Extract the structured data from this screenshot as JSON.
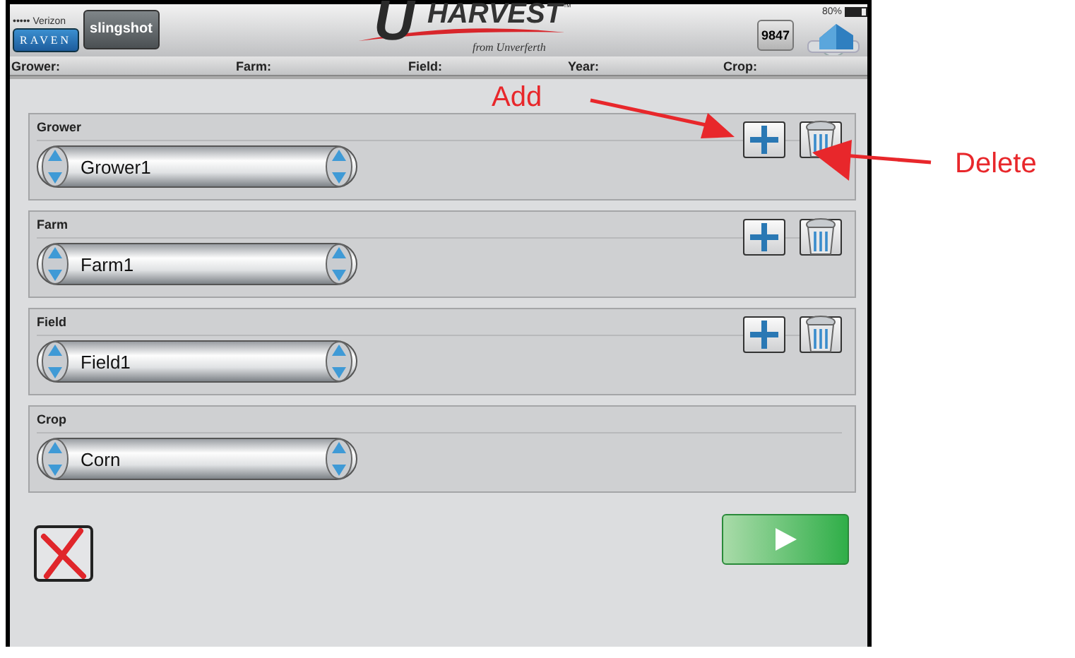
{
  "status_bar": {
    "carrier": "••••• Verizon",
    "battery": "80%"
  },
  "header": {
    "brand_button": "RAVEN",
    "app_button": "slingshot",
    "logo_initial": "U",
    "logo_name": "HARVEST",
    "logo_mark": "™",
    "logo_tagline": "from Unverferth",
    "device_badge": "9847"
  },
  "info_bar": [
    "Grower:",
    "Farm:",
    "Field:",
    "Year:",
    "Crop:"
  ],
  "sections": [
    {
      "label": "Grower",
      "value": "Grower1",
      "kind": "editable"
    },
    {
      "label": "Farm",
      "value": "Farm1",
      "kind": "editable"
    },
    {
      "label": "Field",
      "value": "Field1",
      "kind": "editable"
    },
    {
      "label": "Crop",
      "value": "Corn",
      "kind": "fixed"
    }
  ],
  "annotations": [
    {
      "text": "Add",
      "kind": "add"
    },
    {
      "text": "Delete",
      "kind": "delete"
    }
  ]
}
